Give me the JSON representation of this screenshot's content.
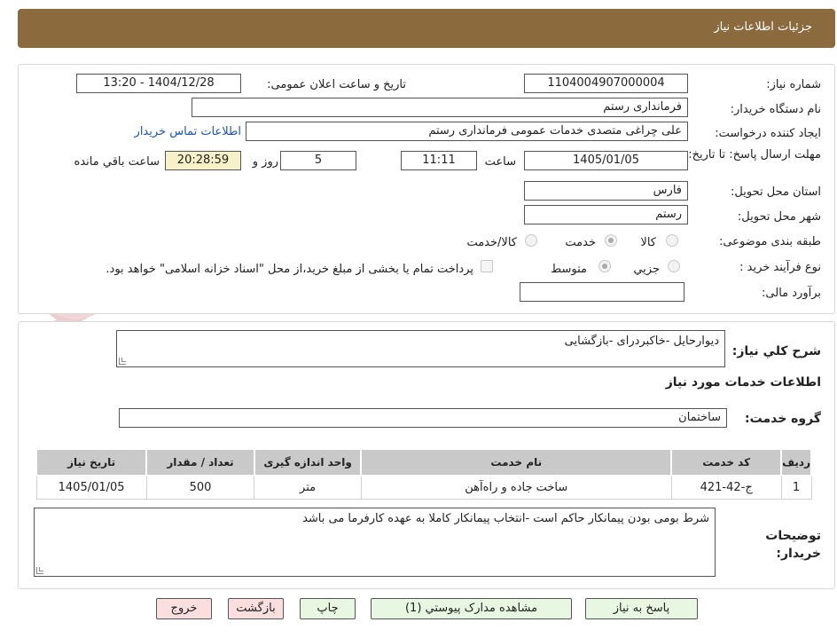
{
  "header": {
    "title": "جزئیات اطلاعات نیاز"
  },
  "form": {
    "need_number_label": "شماره نیاز:",
    "need_number": "1104004907000004",
    "announce_label": "تاریخ و ساعت اعلان عمومی:",
    "announce_value": "1404/12/28 - 13:20",
    "buyer_org_label": "نام دستگاه خریدار:",
    "buyer_org": "فرمانداری رستم",
    "creator_label": "ایجاد کننده درخواست:",
    "creator": "علی چراغی متصدی خدمات عمومی فرمانداری رستم",
    "contact_link": "اطلاعات تماس خریدار",
    "deadline_label": "مهلت ارسال پاسخ: تا تاریخ:",
    "deadline_date": "1405/01/05",
    "time_label": "ساعت",
    "deadline_time": "11:11",
    "days_value": "5",
    "days_label": "روز و",
    "remaining_time": "20:28:59",
    "remaining_label": "ساعت باقي مانده",
    "province_label": "استان محل تحویل:",
    "province": "فارس",
    "city_label": "شهر محل تحویل:",
    "city": "رستم",
    "category_label": "طبقه بندی موضوعی:",
    "category_options": [
      "کالا",
      "خدمت",
      "کالا/خدمت"
    ],
    "process_label": "نوع فرآیند خرید :",
    "process_options": [
      "جزيي",
      "متوسط"
    ],
    "payment_note": "پرداخت تمام یا بخشی از مبلغ خرید،از محل \"اسناد خزانه اسلامی\" خواهد بود.",
    "budget_label": "برآورد مالی:",
    "budget_value": ""
  },
  "section2": {
    "summary_label": "شرح کلي نياز:",
    "summary": "دیوارحایل -خاکبردرای -بازگشایی",
    "services_title": "اطلاعات خدمات مورد نياز",
    "group_label": "گروه خدمت:",
    "group_value": "ساختمان",
    "table": {
      "headers": [
        "رديف",
        "کد خدمت",
        "نام خدمت",
        "واحد اندازه گيری",
        "تعداد / مقدار",
        "تاريخ نياز"
      ],
      "rows": [
        [
          "1",
          "ج-42-421",
          "ساخت جاده و راه‌آهن",
          "متر",
          "500",
          "1405/01/05"
        ]
      ]
    },
    "notes_label": "توضیحات خریدار:",
    "notes": "شرط بومی بودن پیمانکار حاکم است -انتخاب پیمانکار کاملا به عهده کارفرما می باشد"
  },
  "buttons": {
    "reply": "پاسخ به نیاز",
    "attachments": "مشاهده مدارک پیوستي (1)",
    "print": "چاپ",
    "back": "بازگشت",
    "exit": "خروج"
  },
  "watermark": {
    "text": "AriaTender.neT"
  },
  "colors": {
    "header_bg": "#8B6A3E",
    "timer_bg": "#f7f1c8",
    "button_green": "#e8f7e2",
    "button_red": "#fbdede",
    "link": "#1a55c4"
  }
}
